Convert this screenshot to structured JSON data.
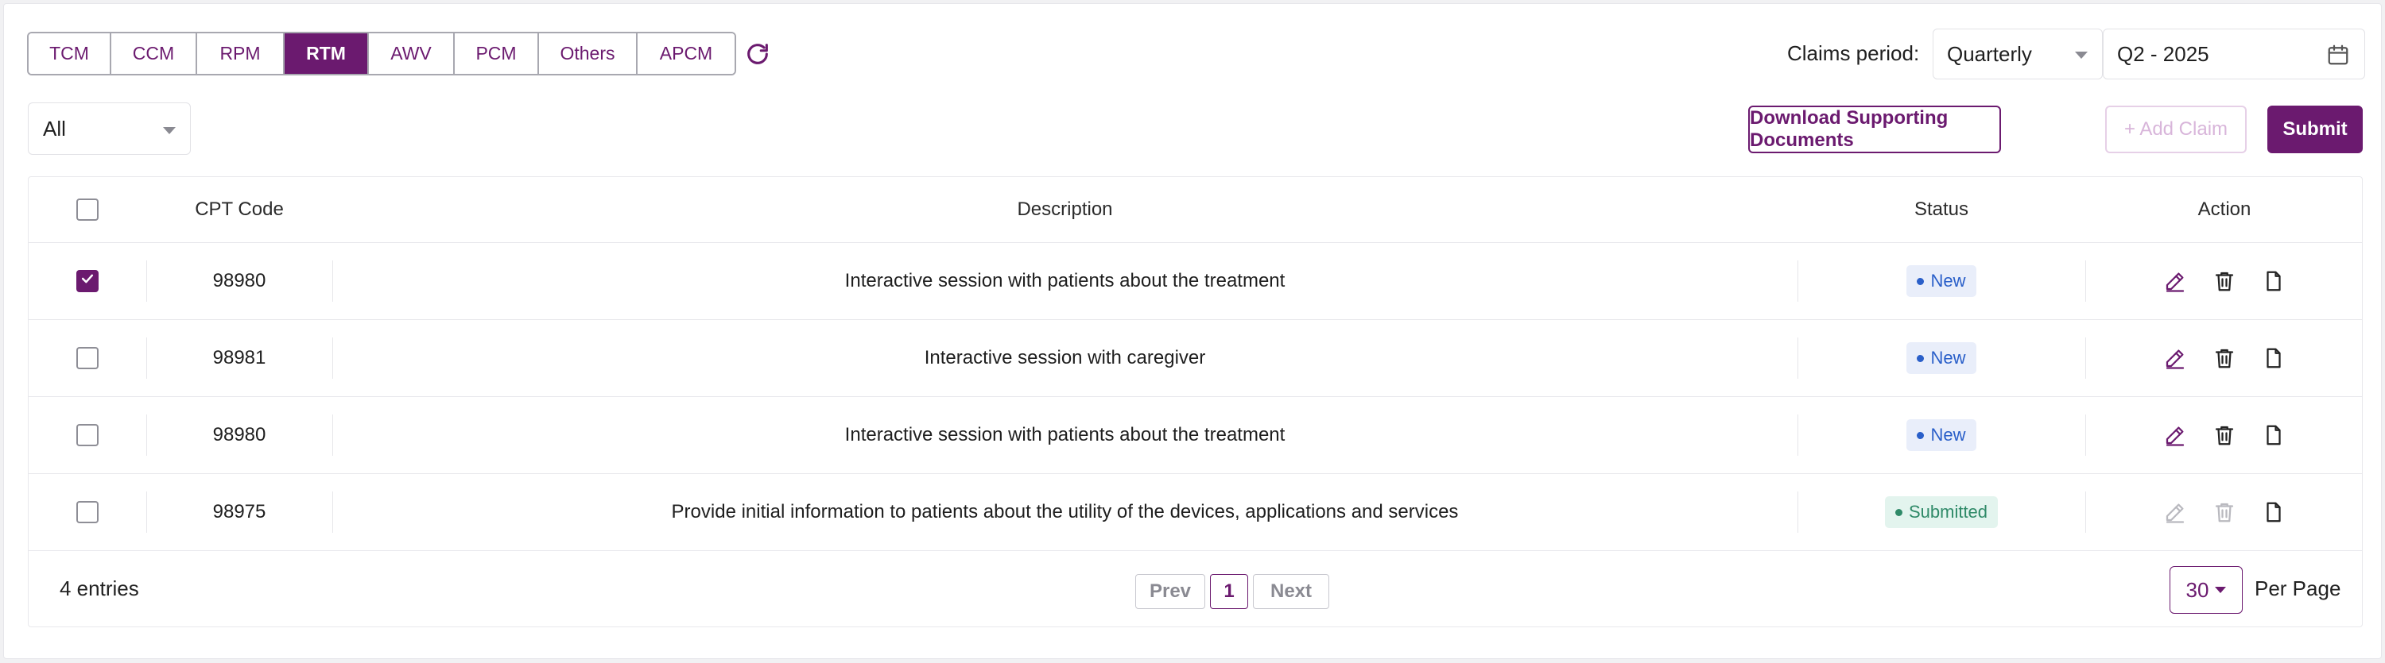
{
  "tabs": [
    "TCM",
    "CCM",
    "RPM",
    "RTM",
    "AWV",
    "PCM",
    "Others",
    "APCM"
  ],
  "active_tab": "RTM",
  "claims": {
    "label": "Claims period:",
    "period": "Quarterly",
    "date": "Q2 - 2025"
  },
  "filter": {
    "value": "All"
  },
  "buttons": {
    "download": "Download Supporting Documents",
    "add_claim": "+ Add Claim",
    "submit": "Submit"
  },
  "table": {
    "headers": {
      "cpt": "CPT Code",
      "description": "Description",
      "status": "Status",
      "action": "Action"
    },
    "rows": [
      {
        "checked": true,
        "cpt": "98980",
        "description": "Interactive session with patients about the treatment",
        "status": "New",
        "editable": true
      },
      {
        "checked": false,
        "cpt": "98981",
        "description": "Interactive session with caregiver",
        "status": "New",
        "editable": true
      },
      {
        "checked": false,
        "cpt": "98980",
        "description": "Interactive session with patients about the treatment",
        "status": "New",
        "editable": true
      },
      {
        "checked": false,
        "cpt": "98975",
        "description": "Provide initial information to patients about the utility of the devices, applications and services",
        "status": "Submitted",
        "editable": false
      }
    ]
  },
  "footer": {
    "entries": "4 entries",
    "prev": "Prev",
    "page": "1",
    "next": "Next",
    "per_page_value": "30",
    "per_page_label": "Per Page"
  },
  "colors": {
    "brand": "#6b1a6f",
    "status_new": "#2a5fc9",
    "status_submitted": "#2f8a68"
  },
  "icons": {
    "refresh": "refresh-icon",
    "calendar": "calendar-icon",
    "edit": "edit-pencil-icon",
    "delete": "trash-icon",
    "document": "document-icon",
    "check": "check-icon"
  }
}
